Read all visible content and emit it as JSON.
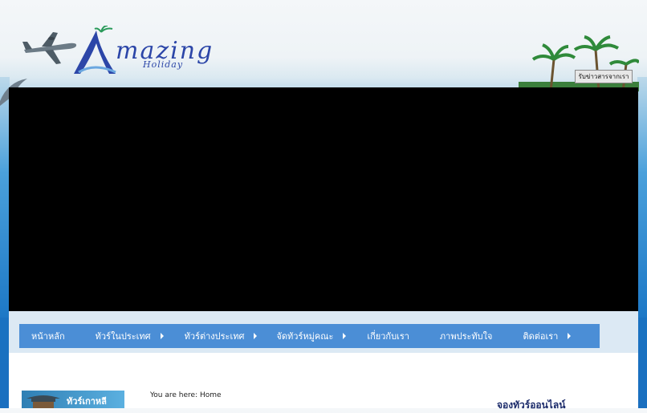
{
  "brand": {
    "name": "mazing",
    "tagline": "Holiday"
  },
  "newsletter": {
    "label": "รับข่าวสารจากเรา"
  },
  "nav": {
    "items": [
      {
        "label": "หน้าหลัก",
        "has_submenu": false
      },
      {
        "label": "ทัวร์ในประเทศ",
        "has_submenu": true
      },
      {
        "label": "ทัวร์ต่างประเทศ",
        "has_submenu": true
      },
      {
        "label": "จัดทัวร์หมู่คณะ",
        "has_submenu": true
      },
      {
        "label": "เกี่ยวกับเรา",
        "has_submenu": false
      },
      {
        "label": "ภาพประทับใจ",
        "has_submenu": false
      },
      {
        "label": "ติดต่อเรา",
        "has_submenu": true
      }
    ]
  },
  "sidebar": {
    "banner_label": "ทัวร์เกาหลี"
  },
  "breadcrumb": {
    "text": "You are here: Home"
  },
  "booking": {
    "title": "จองทัวร์ออนไลน์"
  },
  "colors": {
    "nav_bg": "#4b8ed6",
    "nav_wrap": "#dce9f4",
    "brand": "#2c46a8",
    "hero": "#000000"
  }
}
